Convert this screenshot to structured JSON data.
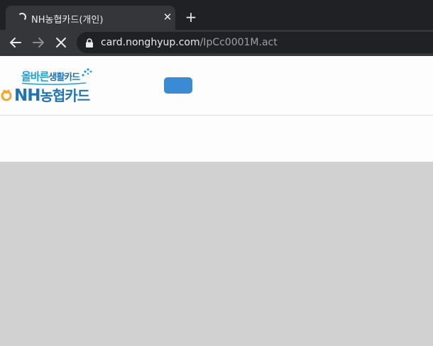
{
  "browser": {
    "tab_title": "NH농협카드(개인)",
    "close_glyph": "✕",
    "newtab_glyph": "+",
    "url_domain": "card.nonghyup.com",
    "url_path": "/IpCc0001M.act"
  },
  "site": {
    "slogan_main": "올바른",
    "slogan_sub": "생활카드",
    "brand_latin": "NH",
    "brand_korean": "농협카드",
    "accent_color": "#3a8bd6",
    "brand_color": "#1d74b8",
    "slogan_color": "#19a0d8",
    "mark_color": "#f5a623"
  }
}
